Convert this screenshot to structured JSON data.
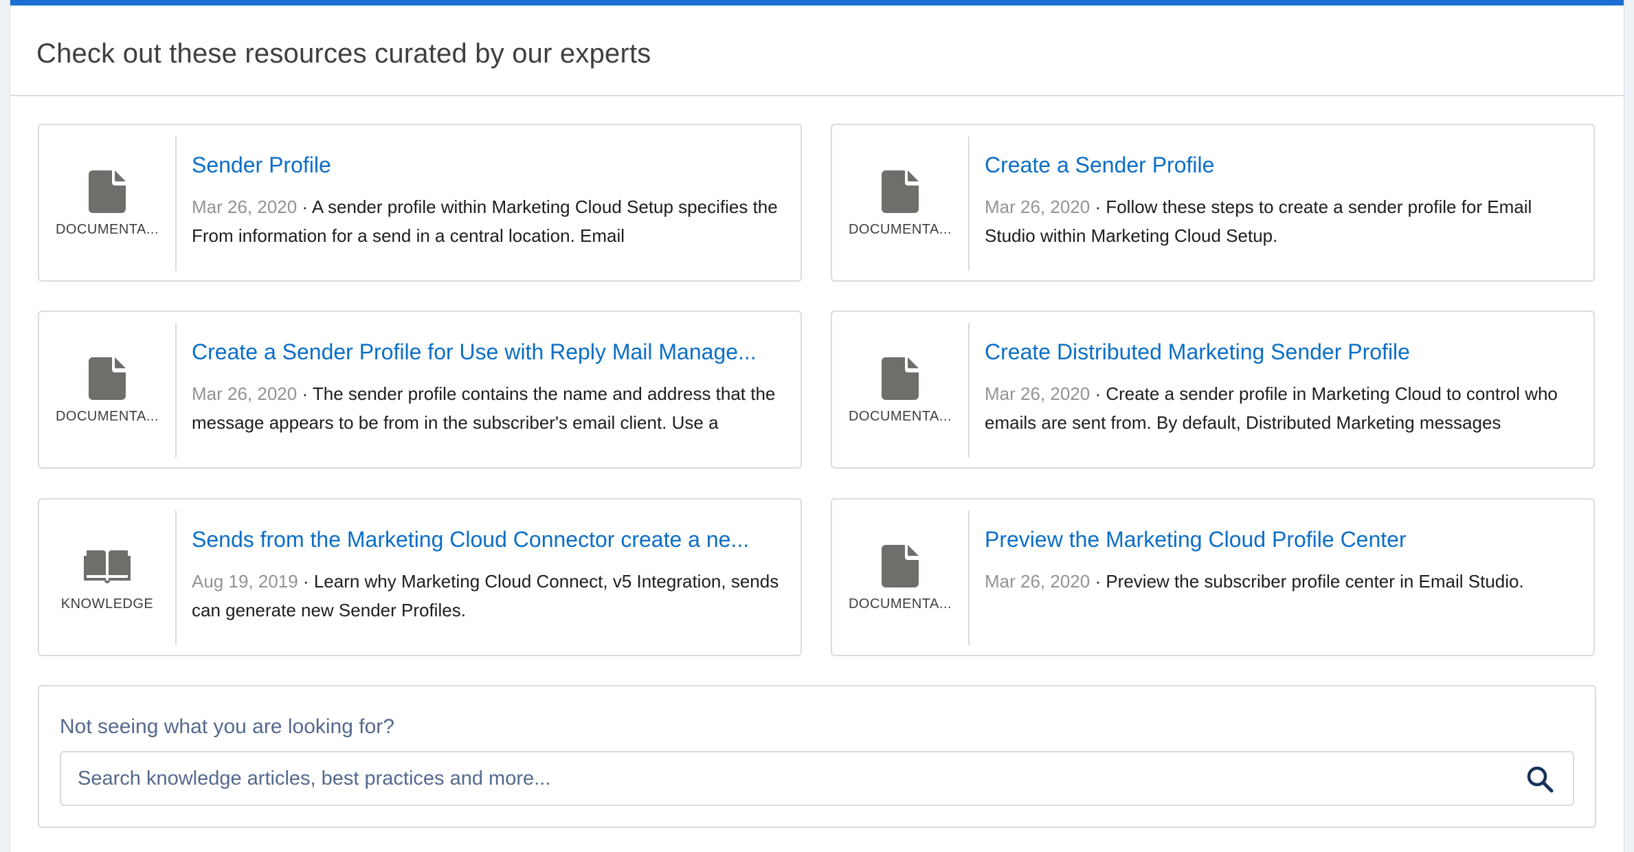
{
  "header": {
    "title": "Check out these resources curated by our experts"
  },
  "cards": [
    {
      "type": "DOCUMENTA...",
      "icon": "document-icon",
      "title": "Sender Profile",
      "date": "Mar 26, 2020",
      "separator": " · ",
      "description": "A sender profile within Marketing Cloud Setup specifies the From information for a send in a central location. Email"
    },
    {
      "type": "DOCUMENTA...",
      "icon": "document-icon",
      "title": "Create a Sender Profile",
      "date": "Mar 26, 2020",
      "separator": " · ",
      "description": "Follow these steps to create a sender profile for Email Studio within Marketing Cloud Setup."
    },
    {
      "type": "DOCUMENTA...",
      "icon": "document-icon",
      "title": "Create a Sender Profile for Use with Reply Mail Manage...",
      "date": "Mar 26, 2020",
      "separator": " · ",
      "description": "The sender profile contains the name and address that the message appears to be from in the subscriber's email client. Use a"
    },
    {
      "type": "DOCUMENTA...",
      "icon": "document-icon",
      "title": "Create Distributed Marketing Sender Profile",
      "date": "Mar 26, 2020",
      "separator": " · ",
      "description": "Create a sender profile in Marketing Cloud to control who emails are sent from. By default, Distributed Marketing messages"
    },
    {
      "type": "KNOWLEDGE",
      "icon": "book-icon",
      "title": "Sends from the Marketing Cloud Connector create a ne...",
      "date": "Aug 19, 2019",
      "separator": " · ",
      "description": "Learn why Marketing Cloud Connect, v5 Integration, sends can generate new Sender Profiles."
    },
    {
      "type": "DOCUMENTA...",
      "icon": "document-icon",
      "title": "Preview the Marketing Cloud Profile Center",
      "date": "Mar 26, 2020",
      "separator": " · ",
      "description": "Preview the subscriber profile center in Email Studio."
    }
  ],
  "search": {
    "prompt": "Not seeing what you are looking for?",
    "placeholder": "Search knowledge articles, best practices and more...",
    "icon": "search-icon"
  },
  "colors": {
    "accent": "#1b6fd1",
    "link": "#0a6ec7",
    "date": "#939393",
    "icon": "#706e6b"
  }
}
